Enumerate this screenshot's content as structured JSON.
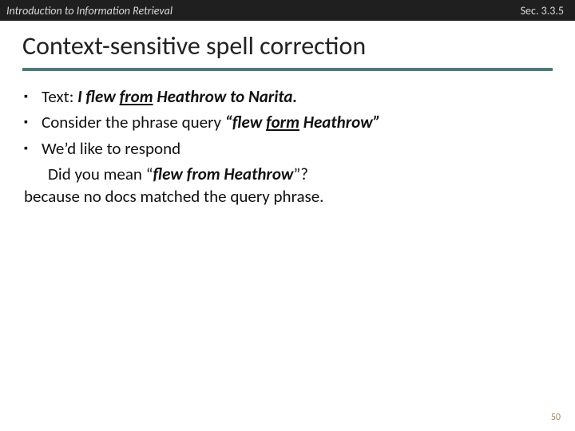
{
  "header": {
    "left": "Introduction to Information Retrieval",
    "right": "Sec. 3.3.5"
  },
  "title": "Context-sensitive spell correction",
  "bullets": {
    "b1": {
      "pre": "Text: ",
      "ital_pre": "I flew ",
      "ital_u1": "from",
      "ital_mid": " Heathrow to Narita."
    },
    "b2": {
      "pre": "Consider the phrase query ",
      "q_open": "“",
      "ital1": "flew ",
      "ital_u": "form",
      "ital2": " Heathrow",
      "q_close": "”"
    },
    "b3": {
      "text": "We’d like to respond"
    },
    "line4": {
      "pre": "Did you mean ",
      "q_open": "“",
      "ital": "flew from Heathrow",
      "q_close": "”",
      "post": "?"
    },
    "line5": "because no docs matched the query phrase."
  },
  "page": "50"
}
